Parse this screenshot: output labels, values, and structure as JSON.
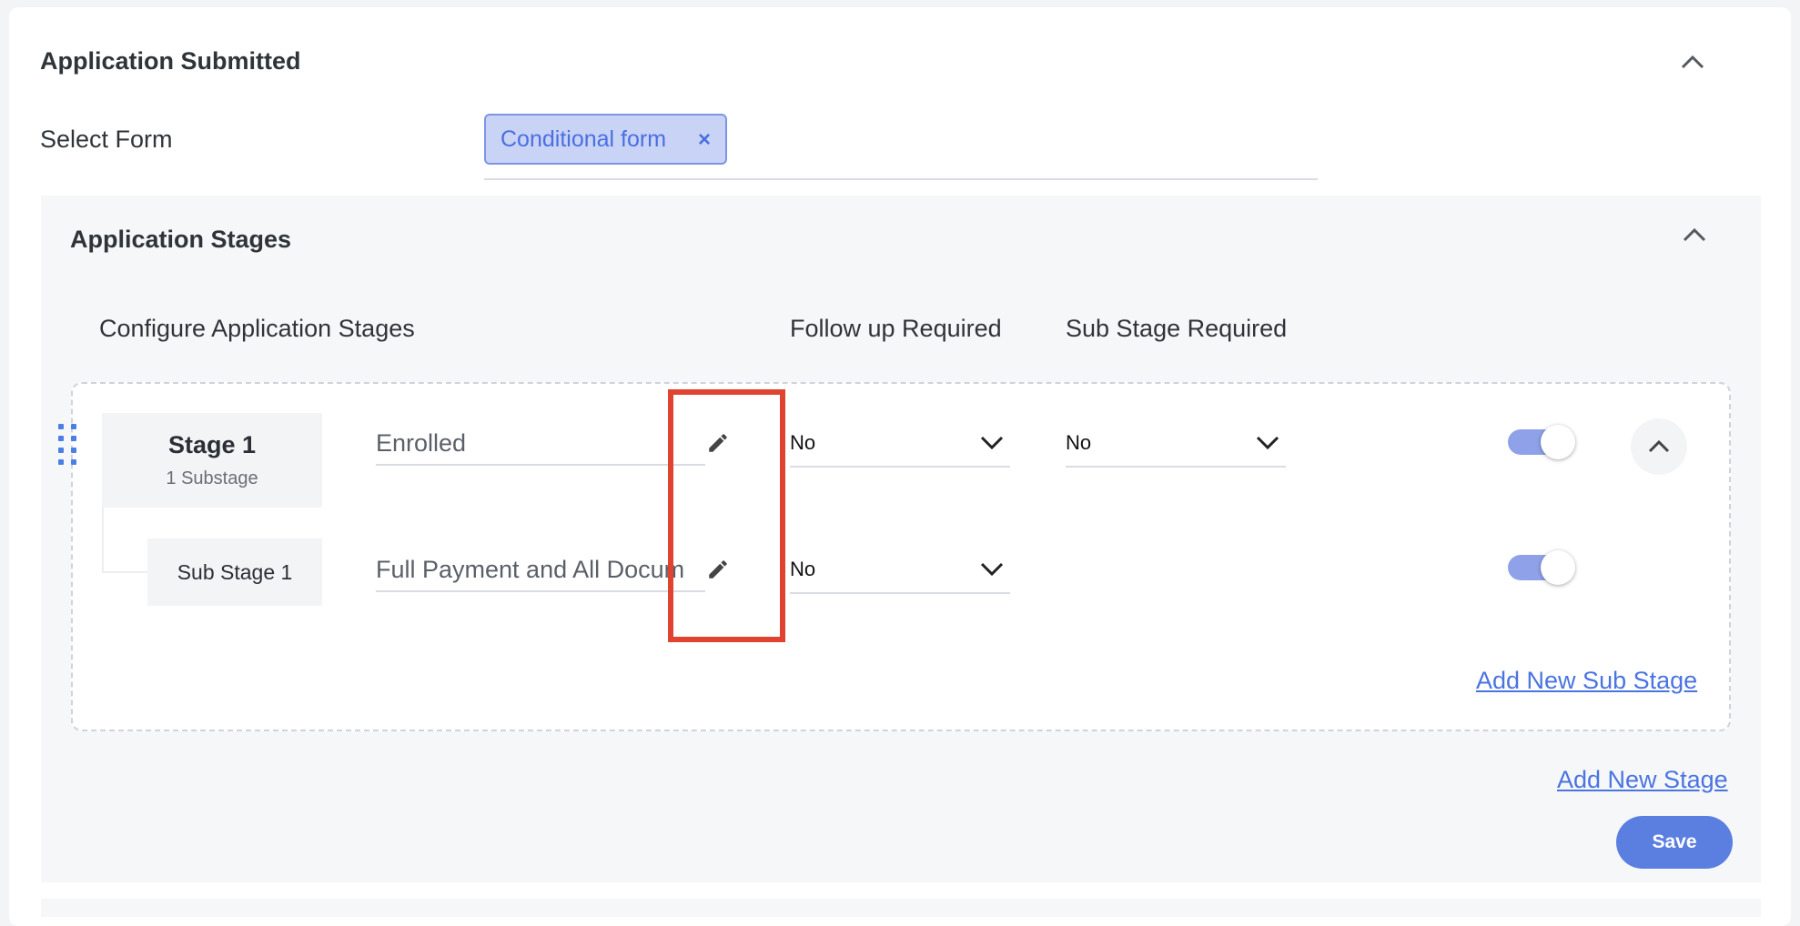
{
  "section": {
    "title": "Application Submitted",
    "select_form_label": "Select Form",
    "selected_form_chip": "Conditional form",
    "chip_remove": "×"
  },
  "stages": {
    "title": "Application Stages",
    "columns": {
      "configure": "Configure Application Stages",
      "follow_up": "Follow up Required",
      "sub_stage": "Sub Stage Required"
    },
    "stage": {
      "name": "Stage 1",
      "substage_count": "1 Substage",
      "field_value": "Enrolled",
      "follow_up_value": "No",
      "sub_stage_value": "No",
      "enabled": true
    },
    "sub_stage": {
      "name": "Sub Stage 1",
      "field_value": "Full Payment and All Docum",
      "follow_up_value": "No",
      "enabled": true
    },
    "add_sub_stage_link": "Add New Sub Stage",
    "add_stage_link": "Add New Stage",
    "save_button": "Save"
  },
  "colors": {
    "accent": "#5a7fe0",
    "link": "#4a74e0",
    "toggle_track": "#8fa1e8",
    "highlight": "#e0432f"
  },
  "icons": [
    "chevron-up-icon",
    "pencil-icon",
    "chevron-down-icon",
    "drag-handle-icon",
    "close-icon"
  ]
}
